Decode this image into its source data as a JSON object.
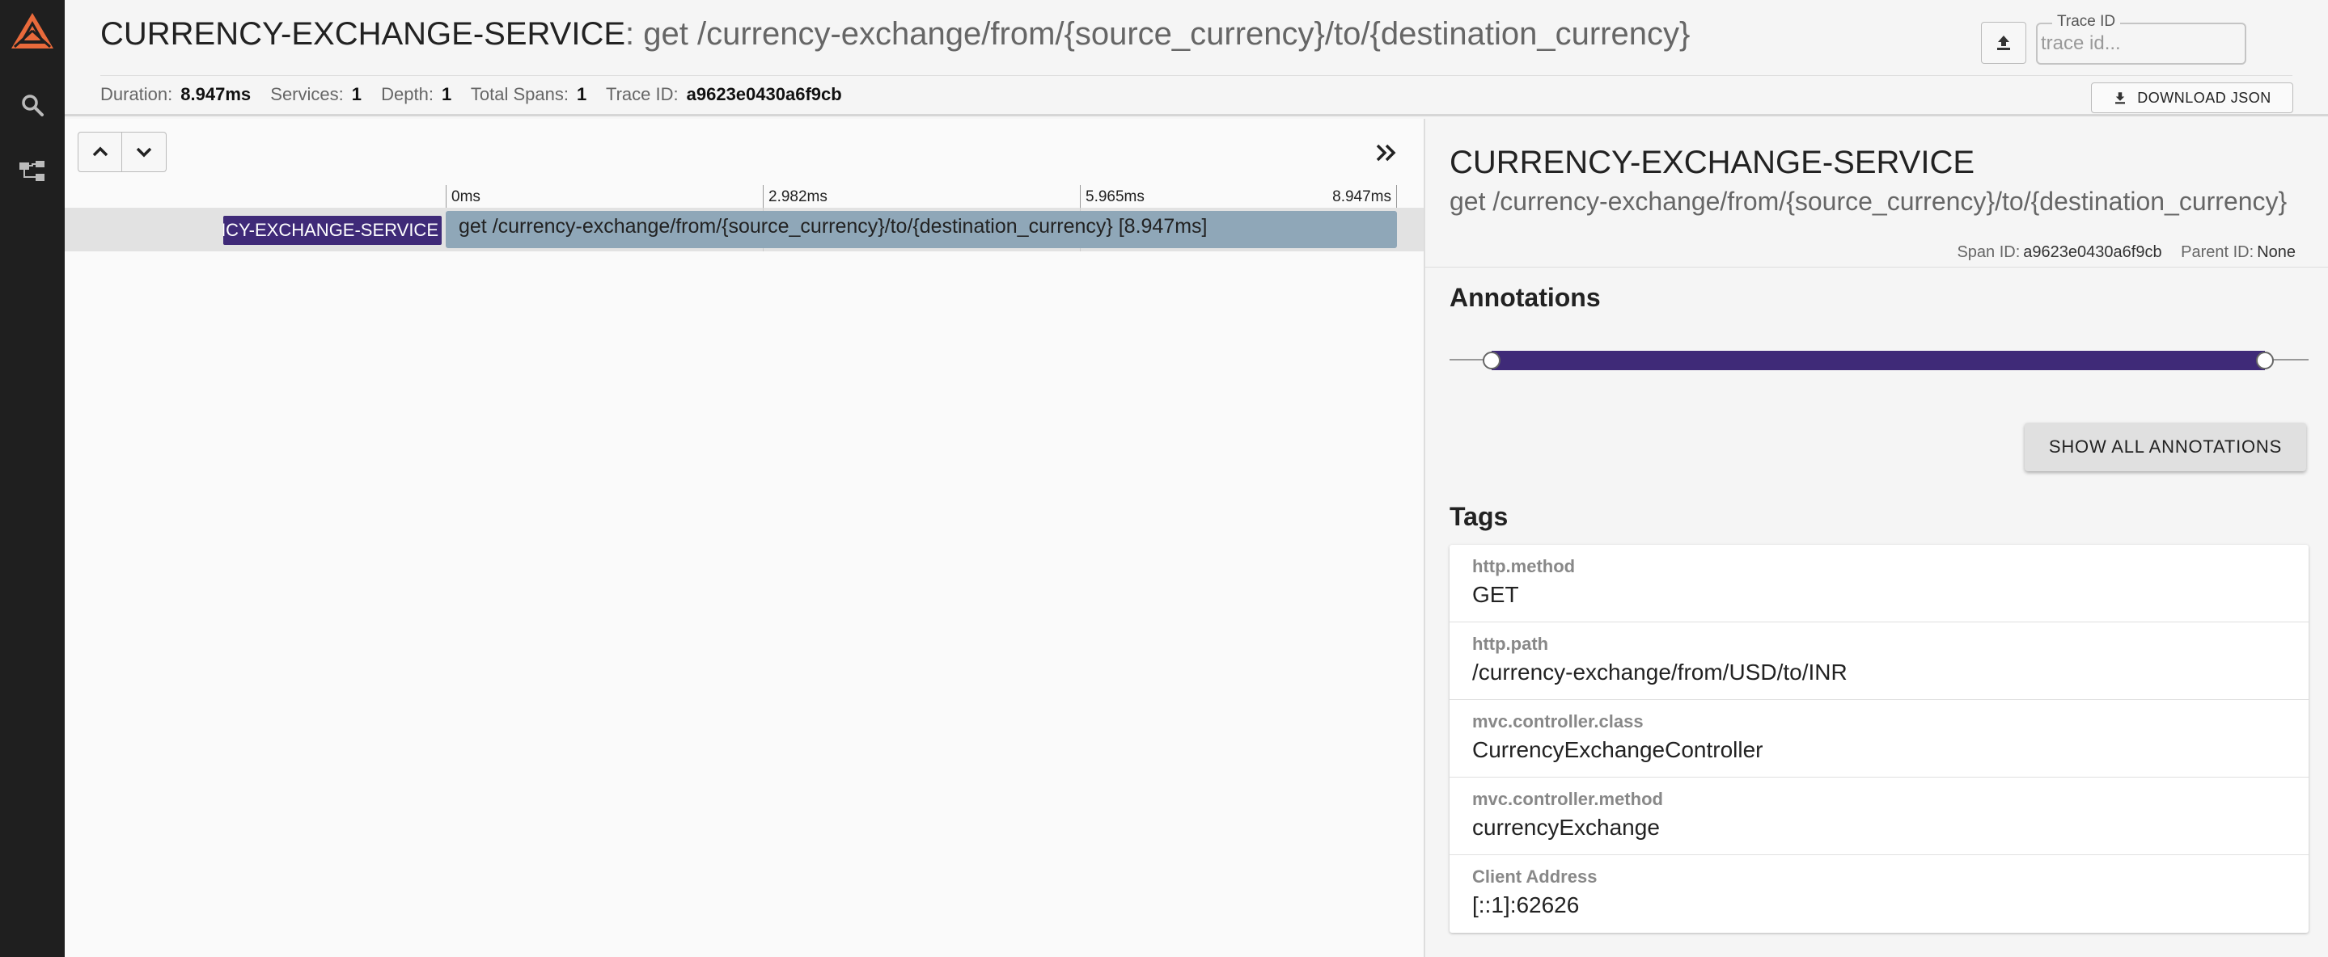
{
  "nav": {
    "logo_icon": "zipkin-logo-icon",
    "items": [
      {
        "icon": "search-icon"
      },
      {
        "icon": "dependencies-icon"
      }
    ],
    "colors": {
      "background": "#1f1f1f",
      "logo": "#e96a3b"
    }
  },
  "header": {
    "service_name": "CURRENCY-EXCHANGE-SERVICE",
    "separator": ": ",
    "operation": "get /currency-exchange/from/{source_currency}/to/{destination_currency}",
    "stats": {
      "duration_label": "Duration:",
      "duration": "8.947ms",
      "services_label": "Services:",
      "services": "1",
      "depth_label": "Depth:",
      "depth": "1",
      "total_spans_label": "Total Spans:",
      "total_spans": "1",
      "trace_id_label": "Trace ID:",
      "trace_id": "a9623e0430a6f9cb"
    },
    "trace_search": {
      "legend": "Trace ID",
      "placeholder": "trace id...",
      "value": ""
    },
    "download_label": "DOWNLOAD JSON",
    "upload_icon": "upload-icon",
    "download_icon": "download-icon"
  },
  "timeline": {
    "ticks": [
      "0ms",
      "2.982ms",
      "5.965ms",
      "8.947ms"
    ],
    "span": {
      "service_label": "CURRENCY-EXCHANGE-SERVICE",
      "bar_label": "get /currency-exchange/from/{source_currency}/to/{destination_currency} [8.947ms]"
    },
    "colors": {
      "service": "#3f2a78",
      "bar": "#8fa7b8"
    }
  },
  "detail": {
    "service_name": "CURRENCY-EXCHANGE-SERVICE",
    "operation": "get /currency-exchange/from/{source_currency}/to/{destination_currency}",
    "span_id_label": "Span ID:",
    "span_id": "a9623e0430a6f9cb",
    "parent_id_label": "Parent ID:",
    "parent_id": "None",
    "annotations_title": "Annotations",
    "show_all_label": "SHOW ALL ANNOTATIONS",
    "tags_title": "Tags",
    "tags": [
      {
        "key": "http.method",
        "value": "GET"
      },
      {
        "key": "http.path",
        "value": "/currency-exchange/from/USD/to/INR"
      },
      {
        "key": "mvc.controller.class",
        "value": "CurrencyExchangeController"
      },
      {
        "key": "mvc.controller.method",
        "value": "currencyExchange"
      },
      {
        "key": "Client Address",
        "value": "[::1]:62626"
      }
    ]
  }
}
